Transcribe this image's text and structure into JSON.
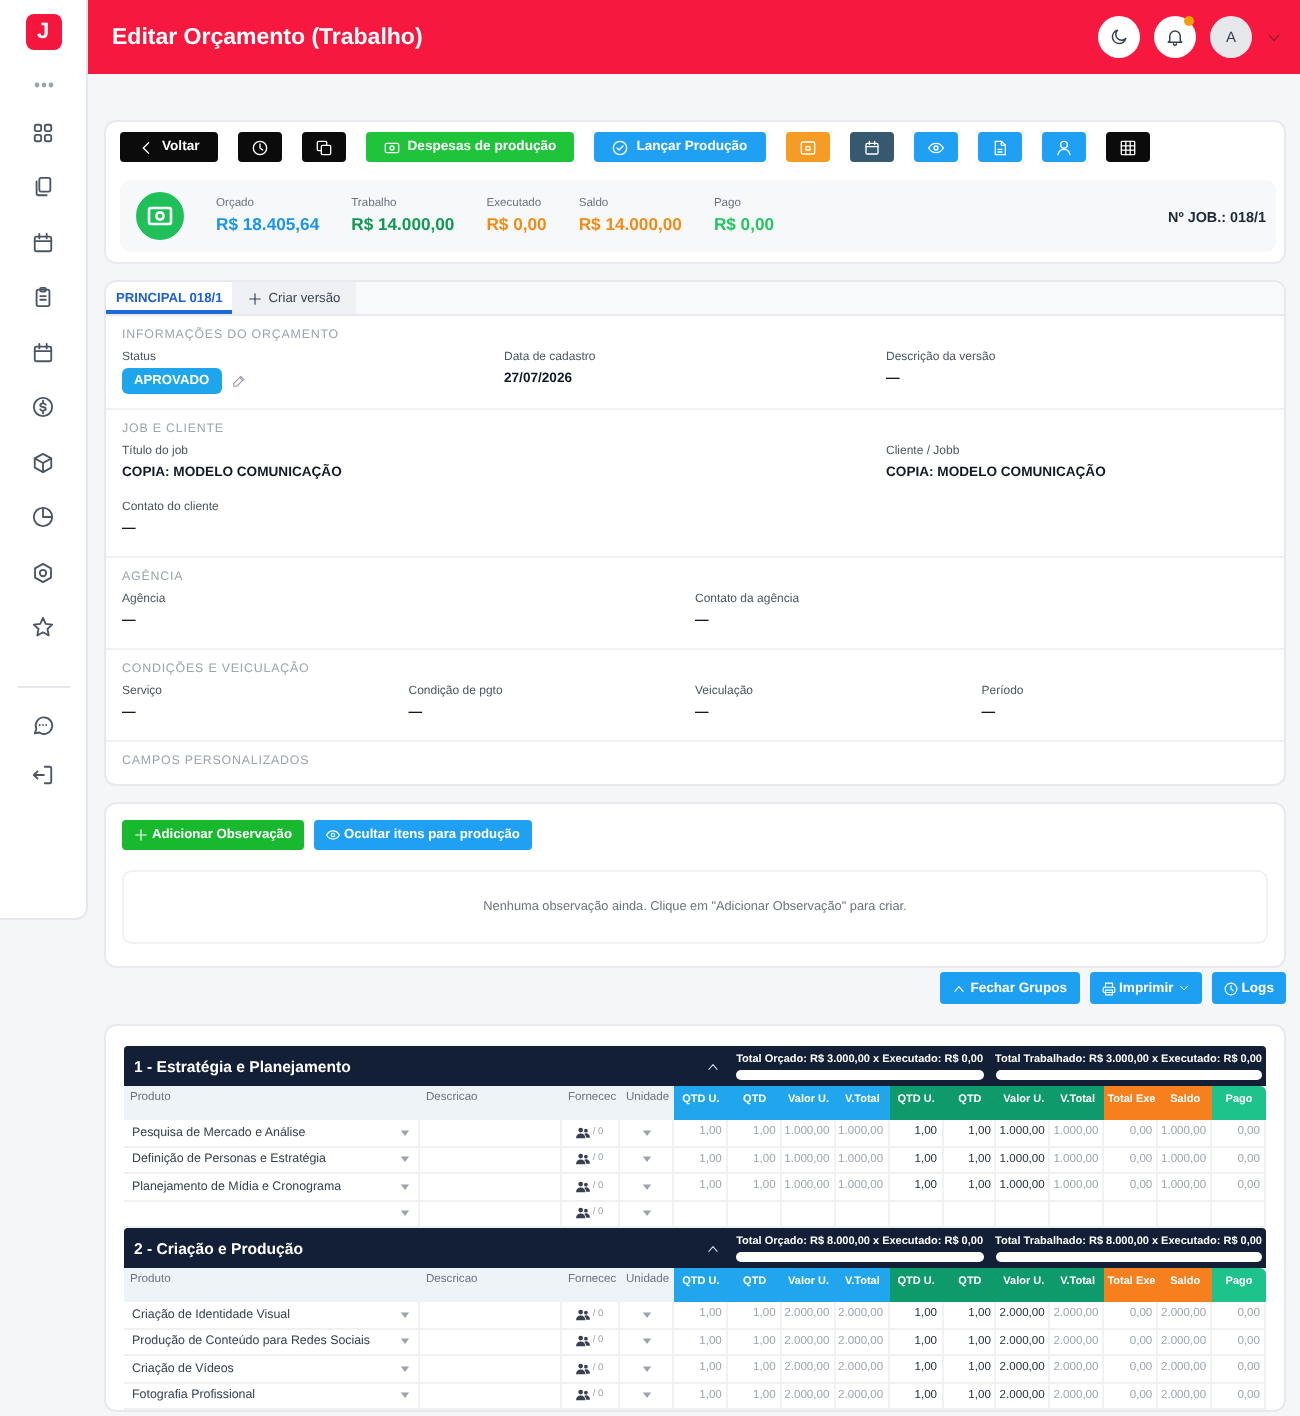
{
  "sidebar": {
    "logo": "J"
  },
  "header": {
    "title": "Editar Orçamento (Trabalho)",
    "notifications_unread": true,
    "avatar": "A"
  },
  "toolbar": [
    {
      "label": "Voltar",
      "color": "#0b0b0b"
    },
    {
      "color": "#0b0b0b"
    },
    {
      "color": "#0b0b0b"
    },
    {
      "label": "Despesas de produção",
      "color": "#1fc43a"
    },
    {
      "label": "Lançar Produção",
      "color": "#1fa0f2"
    },
    {
      "color": "#f59c25"
    },
    {
      "color": "#37596f"
    },
    {
      "color": "#1fa0f2"
    },
    {
      "color": "#1fa0f2"
    },
    {
      "color": "#1fa0f2"
    },
    {
      "color": "#0b0b0b"
    }
  ],
  "summary": {
    "metrics": [
      {
        "label": "Orçado",
        "value": "R$ 18.405,64",
        "color": "#1b95e8"
      },
      {
        "label": "Trabalho",
        "value": "R$ 14.000,00",
        "color": "#0f9a52"
      },
      {
        "label": "Executado",
        "value": "R$ 0,00",
        "color": "#f08c16"
      },
      {
        "label": "Saldo",
        "value": "R$ 14.000,00",
        "color": "#f08c16"
      },
      {
        "label": "Pago",
        "value": "R$ 0,00",
        "color": "#22c55e"
      }
    ],
    "job_number": "Nº JOB.: 018/1"
  },
  "tabs": [
    {
      "label": "PRINCIPAL 018/1",
      "kind": "version",
      "selected": true
    },
    {
      "label": "Criar versão",
      "kind": "add",
      "selected": false
    }
  ],
  "sections": [
    {
      "title": "INFORMAÇÕES DO ORÇAMENTO",
      "fields": [
        {
          "label": "Status",
          "value": "APROVADO",
          "kind": "badge"
        },
        {
          "label": "Data de cadastro",
          "value": "27/07/2026",
          "kind": "text"
        },
        {
          "label": "Descrição da versão",
          "value": "—",
          "kind": "text"
        }
      ]
    },
    {
      "title": "JOB E CLIENTE",
      "fields": [
        {
          "label": "Título do job",
          "value": "COPIA: MODELO COMUNICAÇÃO",
          "kind": "wide"
        },
        {
          "label": "Cliente / Jobb",
          "value": "COPIA: MODELO COMUNICAÇÃO",
          "kind": "text"
        },
        {
          "label": "Contato do cliente",
          "value": "—",
          "kind": "text"
        }
      ]
    },
    {
      "title": "AGÊNCIA",
      "fields": [
        {
          "label": "Agência",
          "value": "—",
          "kind": "text"
        },
        {
          "label": "Contato da agência",
          "value": "—",
          "kind": "text"
        }
      ]
    },
    {
      "title": "CONDIÇÕES E VEICULAÇÃO",
      "fields": [
        {
          "label": "Serviço",
          "value": "—",
          "kind": "text"
        },
        {
          "label": "Condição de pgto",
          "value": "—",
          "kind": "text"
        },
        {
          "label": "Veiculação",
          "value": "—",
          "kind": "text"
        },
        {
          "label": "Período",
          "value": "—",
          "kind": "text"
        }
      ]
    },
    {
      "title": "CAMPOS PERSONALIZADOS"
    }
  ],
  "observations": {
    "buttons": [
      {
        "label": "Adicionar Observação",
        "color": "#18b92f"
      },
      {
        "label": "Ocultar itens para produção",
        "color": "#1fa0f2"
      }
    ],
    "empty_message": "Nenhuma observação ainda. Clique em \"Adicionar Observação\" para criar."
  },
  "actions": [
    {
      "label": "Fechar Grupos",
      "kind": "button"
    },
    {
      "label": "Imprimir",
      "kind": "menu"
    },
    {
      "label": "Logs",
      "kind": "button"
    }
  ],
  "table": {
    "groups": [
      {
        "title": "1 - Estratégia e Planejamento",
        "expanded": true,
        "totals": [
          {
            "text": "Total Orçado: R$ 3.000,00 x Executado: R$ 0,00",
            "level": 0
          },
          {
            "text": "Total Trabalhado: R$ 3.000,00 x Executado: R$ 0,00",
            "level": 0
          }
        ],
        "columns": [
          {
            "label": "Produto",
            "kind": "product"
          },
          {
            "label": "Descricao",
            "kind": "description"
          },
          {
            "label": "Fornecec",
            "kind": "supplier"
          },
          {
            "label": "Unidade",
            "kind": "unit"
          },
          {
            "label": "QTD U.",
            "kind": "value",
            "color": "#21a6ee"
          },
          {
            "label": "QTD",
            "kind": "value",
            "color": "#21a6ee"
          },
          {
            "label": "Valor U.",
            "kind": "value",
            "color": "#21a6ee"
          },
          {
            "label": "V.Total",
            "kind": "value",
            "color": "#21a6ee"
          },
          {
            "label": "QTD U.",
            "kind": "input",
            "color": "#0e9a6a"
          },
          {
            "label": "QTD",
            "kind": "input",
            "color": "#0e9a6a"
          },
          {
            "label": "Valor U.",
            "kind": "input",
            "color": "#0e9a6a"
          },
          {
            "label": "V.Total",
            "kind": "value",
            "color": "#0e9a6a"
          },
          {
            "label": "Total Exe",
            "kind": "value",
            "color": "#f7801e"
          },
          {
            "label": "Saldo",
            "kind": "value",
            "color": "#f7801e"
          },
          {
            "label": "Pago",
            "kind": "value",
            "color": "#1ec28b"
          }
        ],
        "rows": [
          {
            "kind": "item",
            "product": "Pesquisa de Mercado e Análise",
            "supplier": "/ 0",
            "values": [
              "1,00",
              "1,00",
              "1.000,00",
              "1.000,00",
              "1,00",
              "1,00",
              "1.000,00",
              "1.000,00",
              "0,00",
              "1.000,00",
              "0,00"
            ]
          },
          {
            "kind": "item",
            "product": "Definição de Personas e Estratégia",
            "supplier": "/ 0",
            "values": [
              "1,00",
              "1,00",
              "1.000,00",
              "1.000,00",
              "1,00",
              "1,00",
              "1.000,00",
              "1.000,00",
              "0,00",
              "1.000,00",
              "0,00"
            ]
          },
          {
            "kind": "item",
            "product": "Planejamento de Mídia e Cronograma",
            "supplier": "/ 0",
            "values": [
              "1,00",
              "1,00",
              "1.000,00",
              "1.000,00",
              "1,00",
              "1,00",
              "1.000,00",
              "1.000,00",
              "0,00",
              "1.000,00",
              "0,00"
            ]
          },
          {
            "kind": "blank",
            "supplier": "/ 0"
          }
        ]
      },
      {
        "title": "2 - Criação e Produção",
        "expanded": true,
        "totals": [
          {
            "text": "Total Orçado: R$ 8.000,00 x Executado: R$ 0,00",
            "level": 0
          },
          {
            "text": "Total Trabalhado: R$ 8.000,00 x Executado: R$ 0,00",
            "level": 0
          }
        ],
        "columns": [
          {
            "label": "Produto",
            "kind": "product"
          },
          {
            "label": "Descricao",
            "kind": "description"
          },
          {
            "label": "Fornecec",
            "kind": "supplier"
          },
          {
            "label": "Unidade",
            "kind": "unit"
          },
          {
            "label": "QTD U.",
            "kind": "value",
            "color": "#21a6ee"
          },
          {
            "label": "QTD",
            "kind": "value",
            "color": "#21a6ee"
          },
          {
            "label": "Valor U.",
            "kind": "value",
            "color": "#21a6ee"
          },
          {
            "label": "V.Total",
            "kind": "value",
            "color": "#21a6ee"
          },
          {
            "label": "QTD U.",
            "kind": "input",
            "color": "#0e9a6a"
          },
          {
            "label": "QTD",
            "kind": "input",
            "color": "#0e9a6a"
          },
          {
            "label": "Valor U.",
            "kind": "input",
            "color": "#0e9a6a"
          },
          {
            "label": "V.Total",
            "kind": "value",
            "color": "#0e9a6a"
          },
          {
            "label": "Total Exe",
            "kind": "value",
            "color": "#f7801e"
          },
          {
            "label": "Saldo",
            "kind": "value",
            "color": "#f7801e"
          },
          {
            "label": "Pago",
            "kind": "value",
            "color": "#1ec28b"
          }
        ],
        "rows": [
          {
            "kind": "item",
            "product": "Criação de Identidade Visual",
            "supplier": "/ 0",
            "values": [
              "1,00",
              "1,00",
              "2.000,00",
              "2.000,00",
              "1,00",
              "1,00",
              "2.000,00",
              "2.000,00",
              "0,00",
              "2.000,00",
              "0,00"
            ]
          },
          {
            "kind": "item",
            "product": "Produção de Conteúdo para Redes Sociais",
            "supplier": "/ 0",
            "values": [
              "1,00",
              "1,00",
              "2.000,00",
              "2.000,00",
              "1,00",
              "1,00",
              "2.000,00",
              "2.000,00",
              "0,00",
              "2.000,00",
              "0,00"
            ]
          },
          {
            "kind": "item",
            "product": "Criação de Vídeos",
            "supplier": "/ 0",
            "values": [
              "1,00",
              "1,00",
              "2.000,00",
              "2.000,00",
              "1,00",
              "1,00",
              "2.000,00",
              "2.000,00",
              "0,00",
              "2.000,00",
              "0,00"
            ]
          },
          {
            "kind": "item",
            "product": "Fotografia Profissional",
            "supplier": "/ 0",
            "values": [
              "1,00",
              "1,00",
              "2.000,00",
              "2.000,00",
              "1,00",
              "1,00",
              "2.000,00",
              "2.000,00",
              "0,00",
              "2.000,00",
              "0,00"
            ]
          }
        ]
      }
    ]
  }
}
